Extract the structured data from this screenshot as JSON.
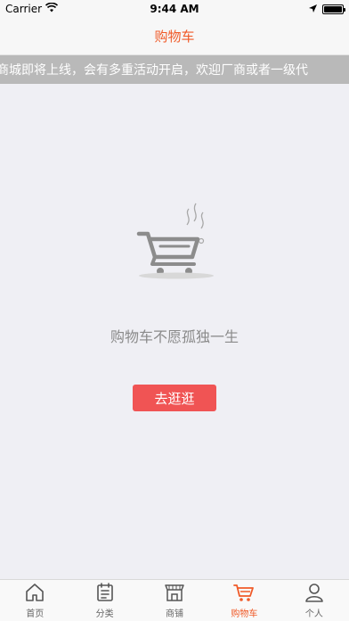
{
  "status_bar": {
    "carrier": "Carrier",
    "time": "9:44 AM",
    "battery_level": 1.0
  },
  "nav": {
    "title": "购物车"
  },
  "announcement": {
    "text": "商城即将上线，会有多重活动开启，欢迎厂商或者一级代"
  },
  "empty_state": {
    "message": "购物车不愿孤独一生",
    "button_label": "去逛逛",
    "icon": "empty-cart-illustration"
  },
  "tab_bar": {
    "active_index": 3,
    "active_color": "#f05a28",
    "items": [
      {
        "label": "首页",
        "icon": "home-icon"
      },
      {
        "label": "分类",
        "icon": "category-icon"
      },
      {
        "label": "商铺",
        "icon": "store-icon"
      },
      {
        "label": "购物车",
        "icon": "cart-icon"
      },
      {
        "label": "个人",
        "icon": "person-icon"
      }
    ]
  }
}
